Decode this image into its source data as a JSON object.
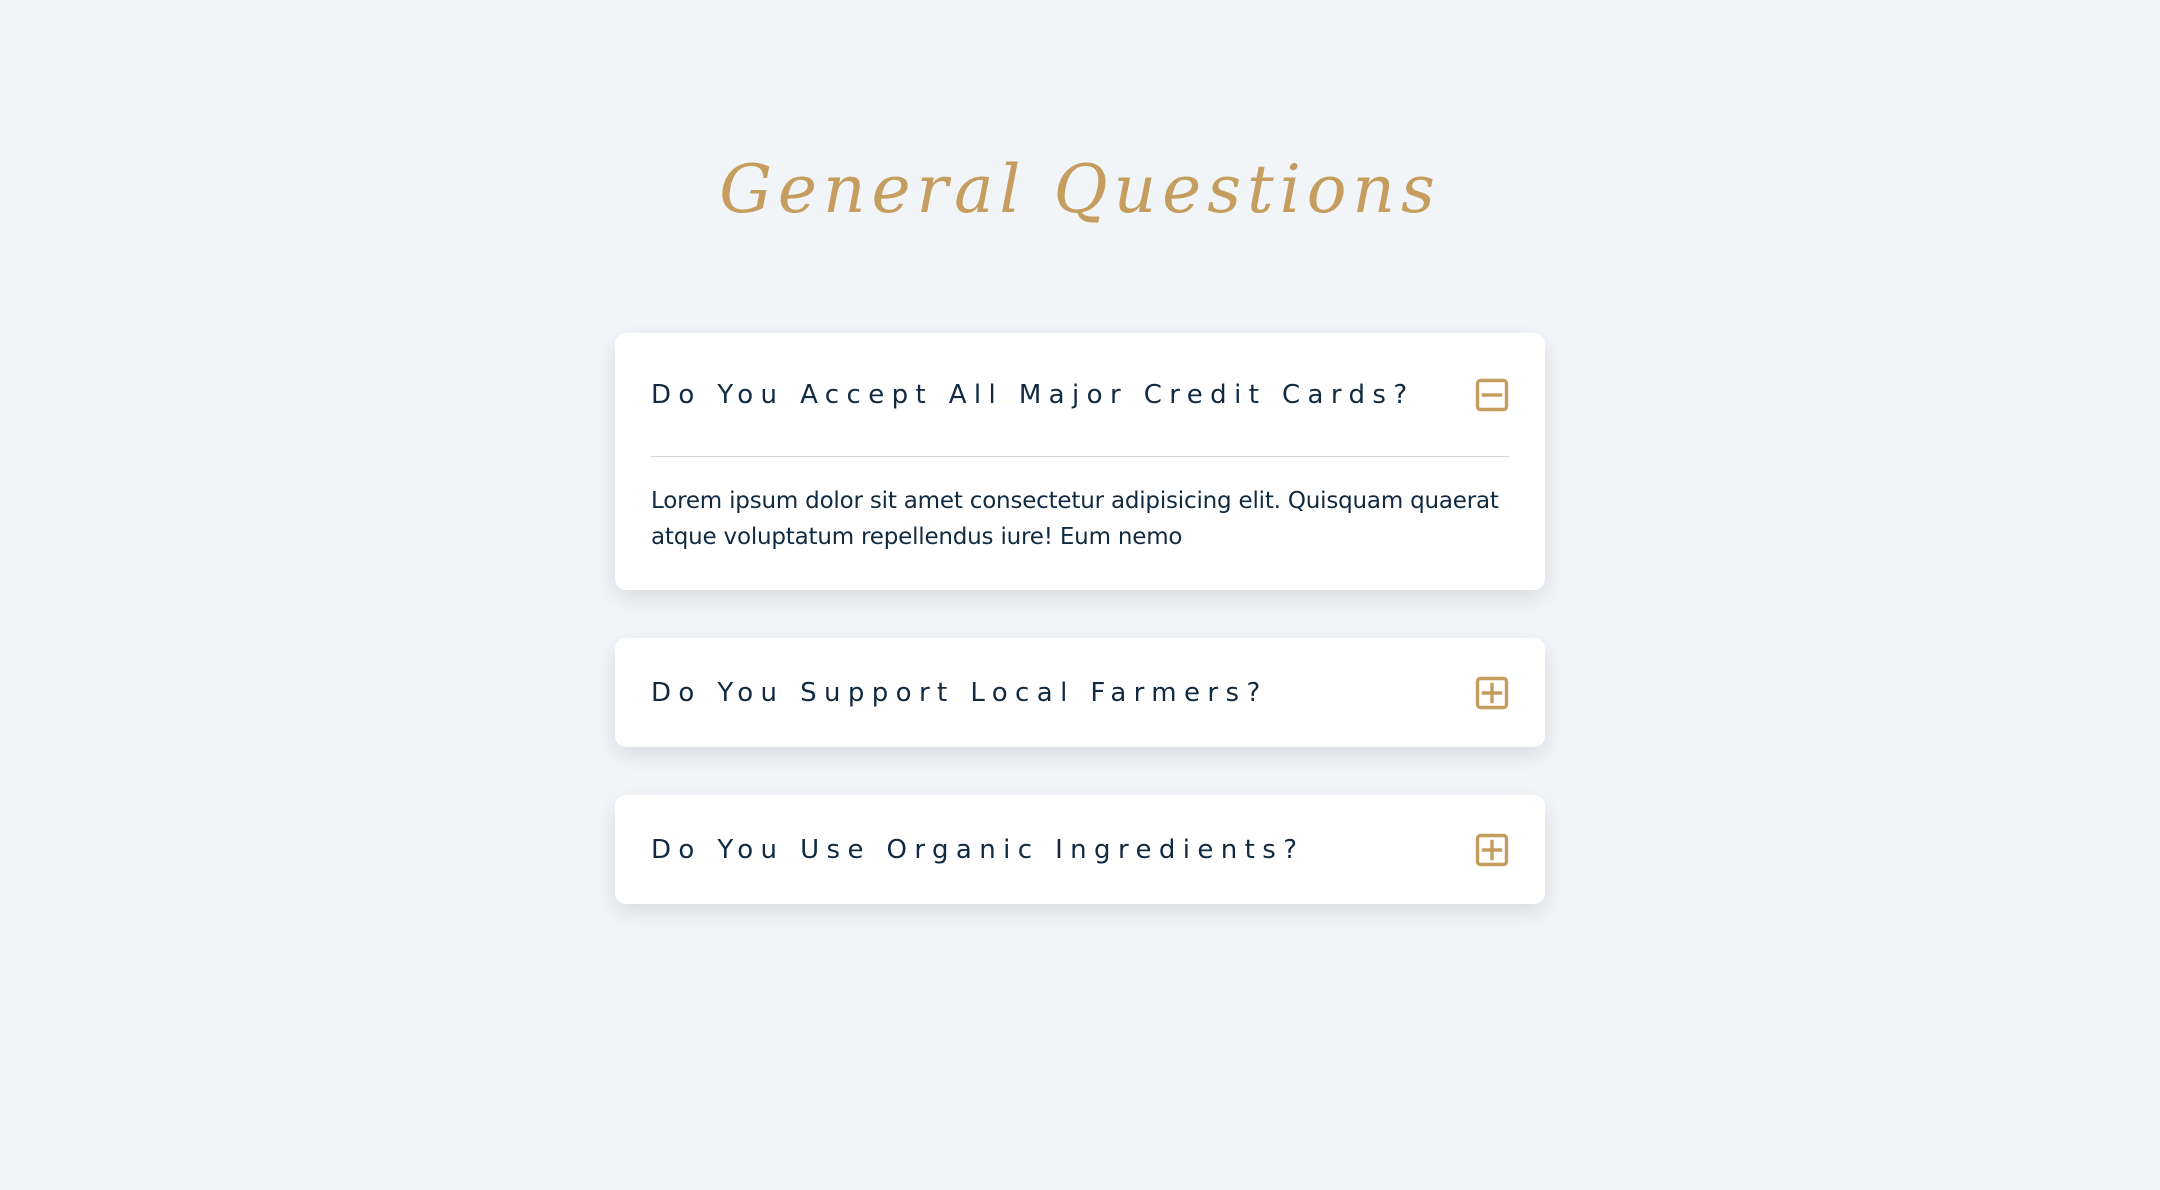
{
  "page": {
    "title": "General Questions"
  },
  "colors": {
    "background": "#f1f5f8",
    "accent": "#c59d5f",
    "text": "#102a42",
    "card": "#ffffff",
    "divider": "#d4d8dc"
  },
  "faq": {
    "items": [
      {
        "question": "Do You Accept All Major Credit Cards?",
        "answer": "Lorem ipsum dolor sit amet consectetur adipisicing elit. Quisquam quaerat atque voluptatum repellendus iure! Eum nemo",
        "expanded": true,
        "icon": "minus-square-icon"
      },
      {
        "question": "Do You Support Local Farmers?",
        "expanded": false,
        "icon": "plus-square-icon"
      },
      {
        "question": "Do You Use Organic Ingredients?",
        "expanded": false,
        "icon": "plus-square-icon"
      }
    ]
  }
}
